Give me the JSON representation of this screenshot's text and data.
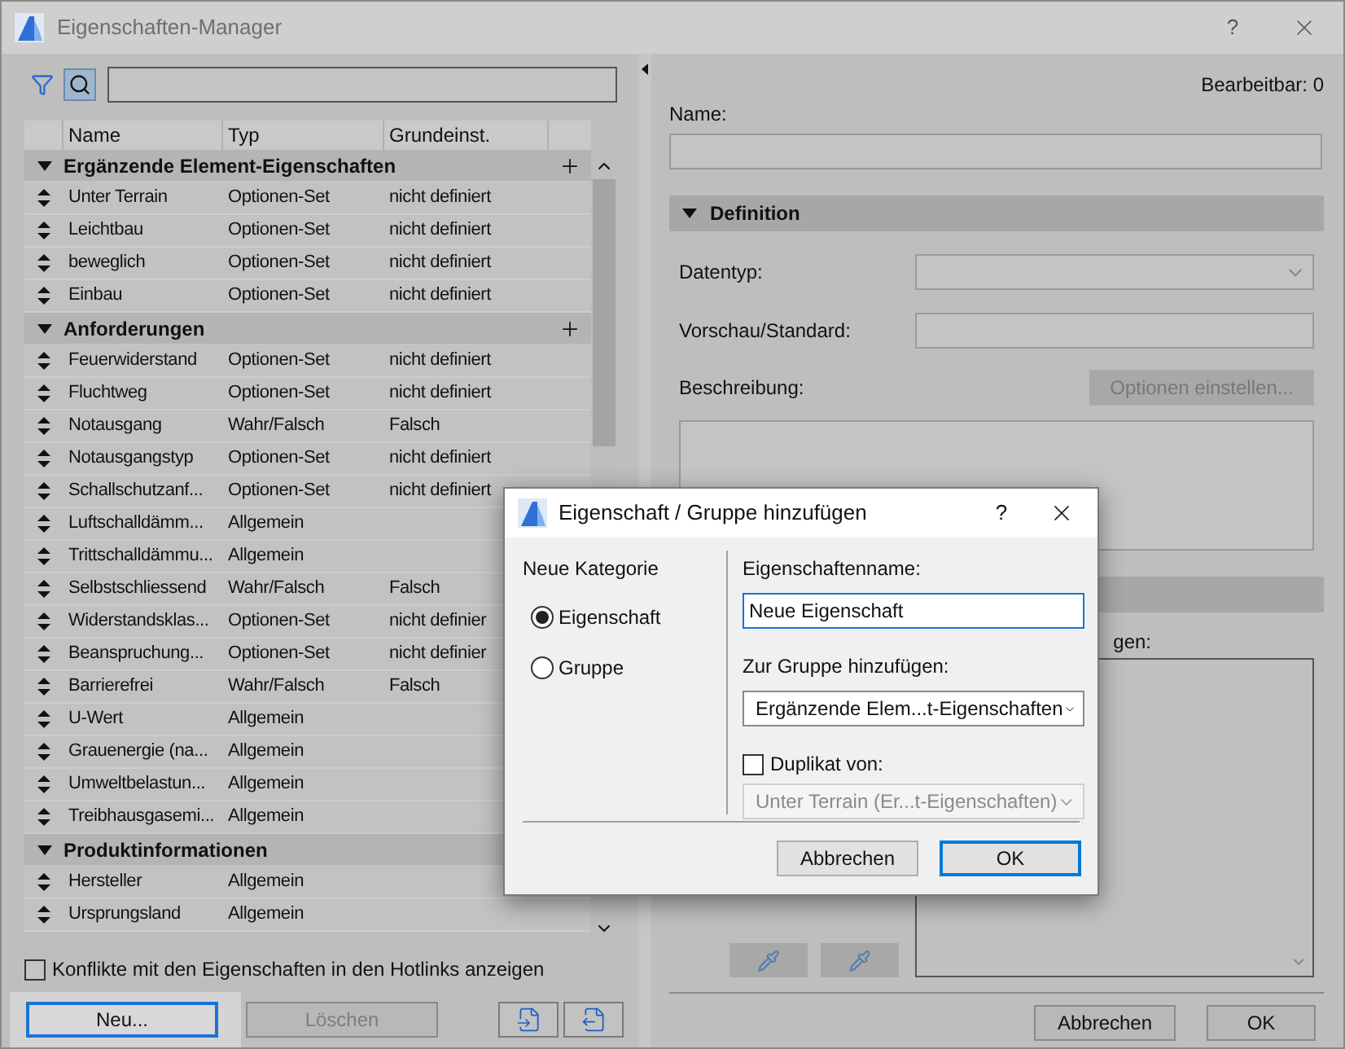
{
  "window": {
    "title": "Eigenschaften-Manager",
    "help": "?"
  },
  "table": {
    "columns": [
      "Name",
      "Typ",
      "Grundeinst."
    ],
    "groups": [
      {
        "name": "Ergänzende Element-Eigenschaften",
        "expanded": true,
        "add_button": true,
        "rows": [
          {
            "name": "Unter Terrain",
            "type": "Optionen-Set",
            "default": "nicht definiert"
          },
          {
            "name": "Leichtbau",
            "type": "Optionen-Set",
            "default": "nicht definiert"
          },
          {
            "name": "beweglich",
            "type": "Optionen-Set",
            "default": "nicht definiert"
          },
          {
            "name": "Einbau",
            "type": "Optionen-Set",
            "default": "nicht definiert"
          }
        ]
      },
      {
        "name": "Anforderungen",
        "expanded": true,
        "add_button": true,
        "rows": [
          {
            "name": "Feuerwiderstand",
            "type": "Optionen-Set",
            "default": "nicht definiert"
          },
          {
            "name": "Fluchtweg",
            "type": "Optionen-Set",
            "default": "nicht definiert"
          },
          {
            "name": "Notausgang",
            "type": "Wahr/Falsch",
            "default": "Falsch"
          },
          {
            "name": "Notausgangstyp",
            "type": "Optionen-Set",
            "default": "nicht definiert"
          },
          {
            "name": "Schallschutzanf...",
            "type": "Optionen-Set",
            "default": "nicht definiert"
          },
          {
            "name": "Luftschalldämm...",
            "type": "Allgemein"
          },
          {
            "name": "Trittschalldämmu...",
            "type": "Allgemein"
          },
          {
            "name": "Selbstschliessend",
            "type": "Wahr/Falsch",
            "default": "Falsch"
          },
          {
            "name": "Widerstandsklas...",
            "type": "Optionen-Set",
            "default": "nicht definier"
          },
          {
            "name": "Beanspruchung...",
            "type": "Optionen-Set",
            "default": "nicht definier"
          },
          {
            "name": "Barrierefrei",
            "type": "Wahr/Falsch",
            "default": "Falsch"
          },
          {
            "name": "U-Wert",
            "type": "Allgemein"
          },
          {
            "name": "Grauenergie (na...",
            "type": "Allgemein"
          },
          {
            "name": "Umweltbelastun...",
            "type": "Allgemein"
          },
          {
            "name": "Treibhausgasemi...",
            "type": "Allgemein"
          }
        ]
      },
      {
        "name": "Produktinformationen",
        "expanded": true,
        "add_button": false,
        "rows": [
          {
            "name": "Hersteller",
            "type": "Allgemein"
          },
          {
            "name": "Ursprungsland",
            "type": "Allgemein"
          }
        ]
      }
    ]
  },
  "hotlink_conflicts": {
    "label": "Konflikte mit den Eigenschaften in den Hotlinks anzeigen",
    "checked": false
  },
  "left_buttons": [
    {
      "label": "Neu...",
      "disabled": false,
      "focused": true
    },
    {
      "label": "Löschen",
      "disabled": true,
      "focused": false
    }
  ],
  "details": {
    "editable": "Bearbeitbar: 0",
    "name_label": "Name:",
    "section": {
      "title": "Definition",
      "expanded": true
    },
    "datatype_label": "Datentyp:",
    "preview_label": "Vorschau/Standard:",
    "description_label": "Beschreibung:",
    "options_button": "Optionen einstellen...",
    "hidden_label_fragment": "gen:"
  },
  "footer_buttons": [
    "Abbrechen",
    "OK"
  ],
  "dialog": {
    "title": "Eigenschaft / Gruppe hinzufügen",
    "help": "?",
    "category_label": "Neue Kategorie",
    "categories": [
      {
        "label": "Eigenschaft",
        "selected": true
      },
      {
        "label": "Gruppe",
        "selected": false
      }
    ],
    "name_label": "Eigenschaftenname:",
    "name_value": "Neue Eigenschaft",
    "group_label": "Zur Gruppe hinzufügen:",
    "group_value": "Ergänzende Elem...t-Eigenschaften",
    "duplicate": {
      "label": "Duplikat von:",
      "checked": false,
      "value": "Unter Terrain (Er...t-Eigenschaften)"
    },
    "buttons": [
      "Abbrechen",
      "OK"
    ]
  }
}
